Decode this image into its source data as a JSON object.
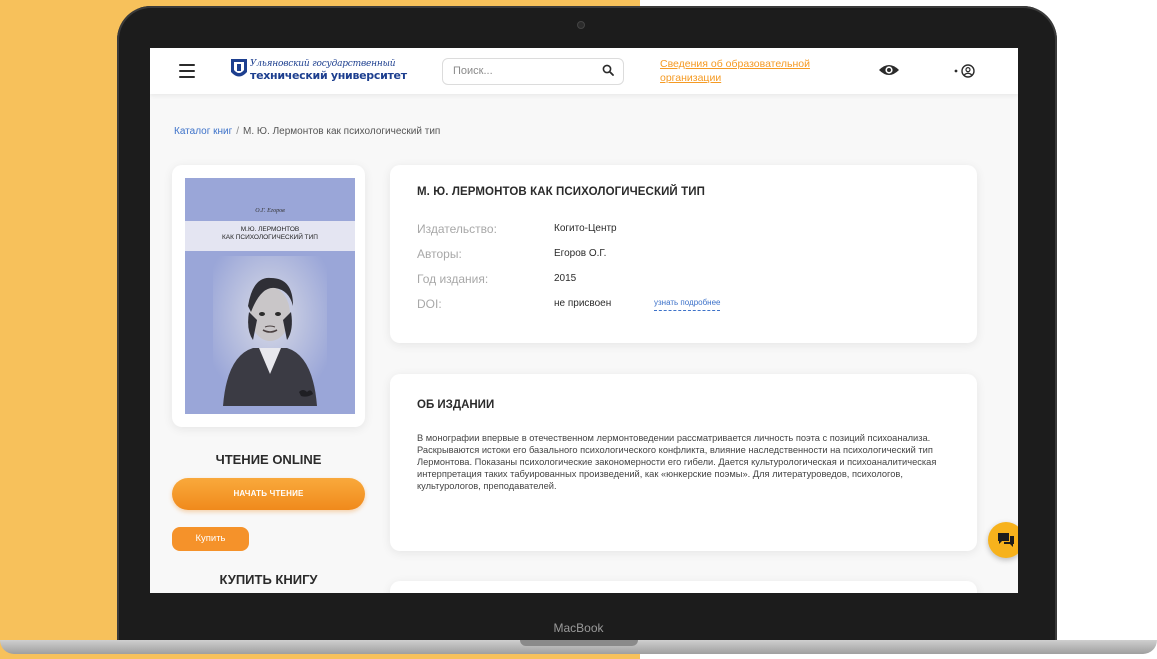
{
  "device": {
    "brand": "MacBook"
  },
  "header": {
    "logo_line1": "Ульяновский государственный",
    "logo_line2": "технический университет",
    "search_placeholder": "Поиск...",
    "info_link": "Сведения об образовательной организации",
    "icons": [
      "menu-icon",
      "search-icon",
      "eye-icon",
      "user-icon"
    ]
  },
  "breadcrumb": {
    "catalog": "Каталог книг",
    "separator": "/",
    "current": "М. Ю. Лермонтов как психологический тип"
  },
  "cover": {
    "author": "О.Г. Егоров",
    "title_line1": "М.Ю. ЛЕРМОНТОВ",
    "title_line2": "КАК ПСИХОЛОГИЧЕСКИЙ ТИП",
    "background_color": "#9aa6d8"
  },
  "sidebar": {
    "read_online_title": "ЧТЕНИЕ ONLINE",
    "start_reading": "НАЧАТЬ ЧТЕНИЕ",
    "buy_button": "Купить",
    "buy_book_title": "КУПИТЬ КНИГУ"
  },
  "book": {
    "title": "М. Ю. ЛЕРМОНТОВ КАК ПСИХОЛОГИЧЕСКИЙ ТИП",
    "publisher_label": "Издательство:",
    "publisher": "Когито-Центр",
    "authors_label": "Авторы:",
    "authors": "Егоров О.Г.",
    "year_label": "Год издания:",
    "year": "2015",
    "doi_label": "DOI:",
    "doi": "не присвоен",
    "doi_more": "узнать подробнее"
  },
  "about": {
    "title": "ОБ ИЗДАНИИ",
    "text": "В монографии впервые в отечественном лермонтоведении рассматривается личность поэта с позиций психоанализа. Раскрываются истоки его базального психологического конфликта, влияние наследственности на психологический тип Лермонтова. Показаны психологические закономерности его гибели. Дается культурологическая и психоаналитическая интерпретация таких табуированных произведений, как «юнкерские поэмы». Для литературоведов, психологов, культурологов, преподавателей."
  },
  "colors": {
    "accent_orange": "#f5922a",
    "link_blue": "#3d72c9",
    "background_yellow": "#f7c15b",
    "chat_button": "#f7b21c"
  },
  "chat": {
    "icon": "chat-icon"
  }
}
